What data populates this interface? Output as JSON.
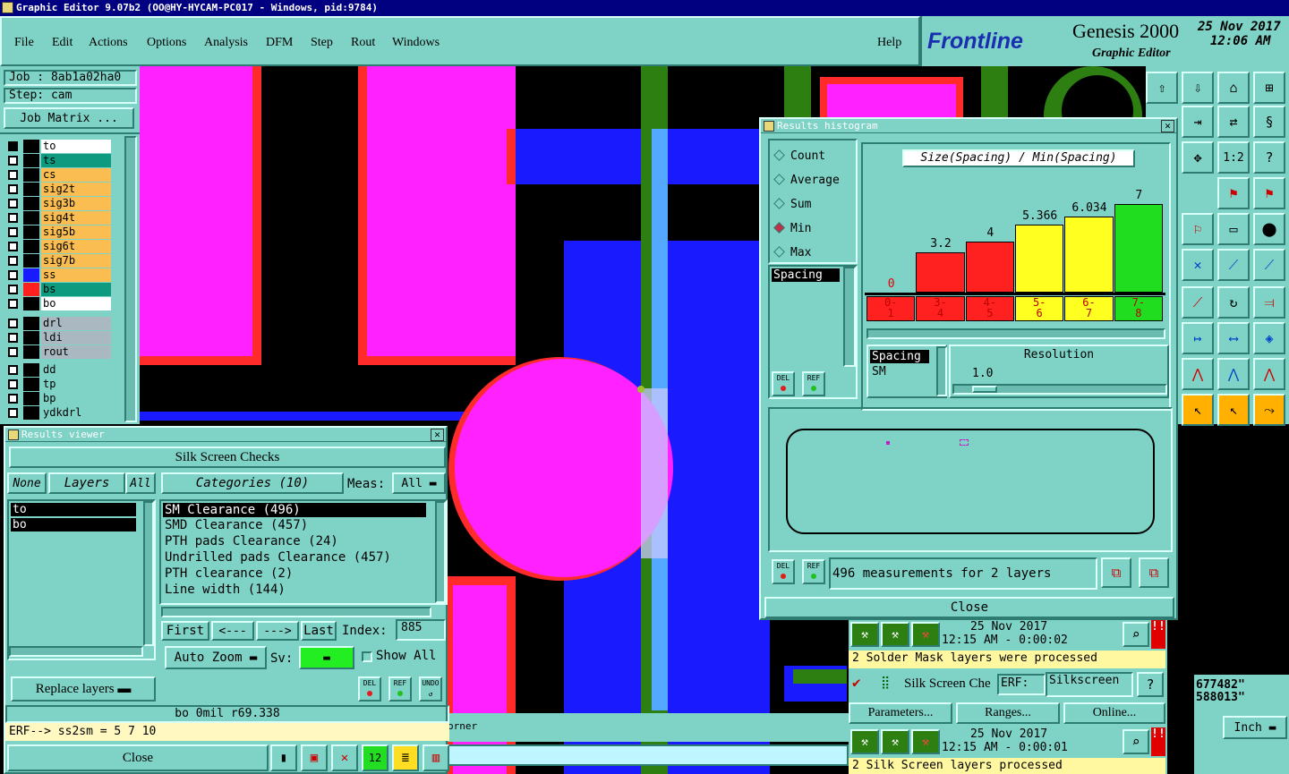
{
  "window": {
    "title": "Graphic Editor 9.07b2 (OO@HY-HYCAM-PC017 - Windows, pid:9784)"
  },
  "menu": [
    "File",
    "Edit",
    "Actions",
    "Options",
    "Analysis",
    "DFM",
    "Step",
    "Rout",
    "Windows"
  ],
  "help_label": "Help",
  "brand": {
    "logo": "Frontline",
    "product": "Genesis 2000",
    "subtitle": "Graphic Editor",
    "date": "25 Nov 2017",
    "time": "12:06 AM"
  },
  "job": {
    "job_label": "Job : 8ab1a02ha0",
    "step_label": "Step: cam",
    "matrix_button": "Job Matrix ..."
  },
  "layers": {
    "board": [
      {
        "name": "to",
        "color": "#000000",
        "bg": "#ffffff",
        "sel": "#000000"
      },
      {
        "name": "ts",
        "color": "#000000",
        "bg": "#0e9a7e"
      },
      {
        "name": "cs",
        "color": "#000000",
        "bg": "#f9bd52"
      },
      {
        "name": "sig2t",
        "color": "#000000",
        "bg": "#f9bd52"
      },
      {
        "name": "sig3b",
        "color": "#000000",
        "bg": "#f9bd52"
      },
      {
        "name": "sig4t",
        "color": "#000000",
        "bg": "#f9bd52"
      },
      {
        "name": "sig5b",
        "color": "#000000",
        "bg": "#f9bd52"
      },
      {
        "name": "sig6t",
        "color": "#000000",
        "bg": "#f9bd52"
      },
      {
        "name": "sig7b",
        "color": "#000000",
        "bg": "#f9bd52"
      },
      {
        "name": "ss",
        "color": "#1a1aff",
        "bg": "#f9bd52"
      },
      {
        "name": "bs",
        "color": "#ff2020",
        "bg": "#0e9a7e"
      },
      {
        "name": "bo",
        "color": "#000000",
        "bg": "#ffffff"
      }
    ],
    "drill": [
      {
        "name": "drl",
        "bg": "#a9b8c1"
      },
      {
        "name": "ldi",
        "bg": "#a9b8c1"
      },
      {
        "name": "rout",
        "bg": "#a9b8c1"
      }
    ],
    "misc": [
      {
        "name": "dd",
        "bg": "#7fd2c6"
      },
      {
        "name": "tp",
        "bg": "#7fd2c6"
      },
      {
        "name": "bp",
        "bg": "#7fd2c6"
      },
      {
        "name": "ydkdrl",
        "bg": "#7fd2c6"
      }
    ]
  },
  "results_viewer": {
    "title": "Results viewer",
    "heading": "Silk Screen Checks",
    "none_btn": "None",
    "layers_btn": "Layers",
    "all_btn": "All",
    "categories_btn": "Categories (10)",
    "meas_label": "Meas:",
    "meas_value": "All",
    "layer_list": [
      "to",
      "bo"
    ],
    "categories": [
      "SM Clearance (496)",
      "SMD Clearance (457)",
      "PTH pads Clearance (24)",
      "Undrilled pads Clearance (457)",
      "PTH clearance (2)",
      "Line width (144)"
    ],
    "first": "First",
    "prev": "<---",
    "next": "--->",
    "last": "Last",
    "index_label": "Index:",
    "index_value": "885",
    "auto_zoom": "Auto Zoom",
    "sv_label": "Sv:",
    "show_all": "Show All",
    "replace_layers": "Replace layers",
    "del": "DEL",
    "ref": "REF",
    "undo": "UNDO",
    "status": "bo  0mil  r69.338",
    "erf_line": "ERF--> ss2sm = 5 7 10",
    "close": "Close"
  },
  "histogram": {
    "title": "Results histogram",
    "modes": [
      "Count",
      "Average",
      "Sum",
      "Min",
      "Max"
    ],
    "selected_mode": "Min",
    "chart_title": "Size(Spacing) / Min(Spacing)",
    "attr_list": [
      "Spacing"
    ],
    "bottom_list": [
      "Spacing",
      "SM"
    ],
    "resolution_label": "Resolution",
    "resolution_value": "1.0",
    "summary": "496 measurements for 2 layers",
    "del": "DEL",
    "ref": "REF",
    "close": "Close"
  },
  "chart_data": {
    "type": "bar",
    "title": "Size(Spacing) / Min(Spacing)",
    "categories": [
      "0-1",
      "3-4",
      "4-5",
      "5-6",
      "6-7",
      "7-8"
    ],
    "values": [
      0,
      3.2,
      4,
      5.366,
      6.034,
      7
    ],
    "value_labels": [
      "0",
      "3.2",
      "4",
      "5.366",
      "6.034",
      "7"
    ],
    "bar_colors": [
      "#ff2020",
      "#ff2020",
      "#ff2020",
      "#ffff20",
      "#ffff20",
      "#20dd20"
    ],
    "ylim": [
      0,
      7.5
    ]
  },
  "erf_panel": {
    "date1": "25 Nov 2017",
    "time1": "12:15 AM - 0:00:02",
    "msg1": "2 Solder Mask layers were processed",
    "action": "Silk Screen Che",
    "erf_label": "ERF:",
    "erf_value": "Silkscreen",
    "parameters": "Parameters...",
    "ranges": "Ranges...",
    "online": "Online...",
    "date2": "25 Nov 2017",
    "time2": "12:15 AM - 0:00:01",
    "msg2": "2 Silk Screen layers processed",
    "q": "?"
  },
  "coords": {
    "x": "677482\"",
    "y": "588013\"",
    "units": "Inch"
  },
  "footer": {
    "hint": "orner"
  }
}
